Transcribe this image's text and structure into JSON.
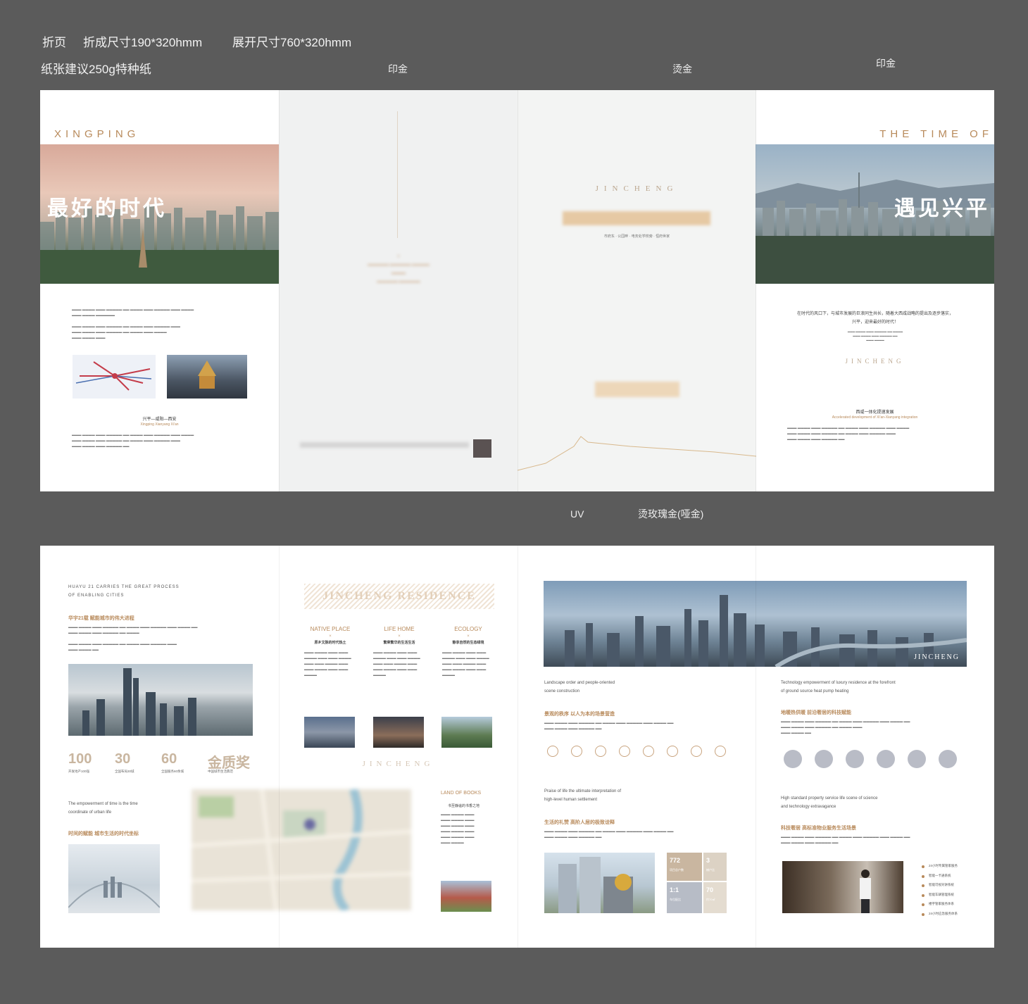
{
  "specs": {
    "fold_label": "折页",
    "folded_size": "折成尺寸190*320hmm",
    "open_size": "展开尺寸760*320hmm",
    "paper": "纸张建议250g特种纸"
  },
  "finish_labels": {
    "top_left": "印金",
    "top_center": "烫金",
    "top_right": "印金",
    "mid_left": "UV",
    "mid_right": "烫玫瑰金(哑金)"
  },
  "sheet1": {
    "p1": {
      "heading_en": "XINGPING",
      "photo_title": "最好的时代",
      "caption_title": "兴平—咸阳—西安",
      "caption_sub": "Xingping Xianyang Xi'an"
    },
    "p3": {
      "brand": "JINCHENG",
      "tagline": "市府东 · 公园畔 · 电务处学校旁 · 恒府世家"
    },
    "p4": {
      "heading_en": "THE TIME OF",
      "photo_title": "遇见兴平",
      "intro_1": "在时代的风口下，与城市发展的巨浪同生共长，随着大西咸战略的提出及逐步落实，",
      "intro_2": "兴平，迎来最好的时代！",
      "brand": "JINCHENG",
      "section_title": "西咸一体化提速发展",
      "section_sub": "Accelerated development of Xi'an-Xianyang integration"
    }
  },
  "sheet2": {
    "p1": {
      "en_1": "HUAYU 21 CARRIES THE GREAT PROCESS",
      "en_2": "OF ENABLING CITIES",
      "title": "华宇21载 赋能城市的伟大进程",
      "stats": [
        {
          "value": "100",
          "label": "开发地产100强"
        },
        {
          "value": "30",
          "label": "全国布局30城"
        },
        {
          "value": "60",
          "label": "全国服务60余城"
        },
        {
          "value": "金质奖",
          "label": "中国城市生活典范"
        }
      ],
      "en_3": "The empowerment of time is the time",
      "en_4": "coordinate of urban life",
      "title_2": "时间的赋能 城市生活的时代坐标"
    },
    "p2": {
      "banner": "JINCHENG RESIDENCE",
      "cols": [
        {
          "en": "NATIVE PLACE",
          "cn": "原乡文脉的时代热土"
        },
        {
          "en": "LIFE HOME",
          "cn": "繁荣繁华的生活生活"
        },
        {
          "en": "ECOLOGY",
          "cn": "静享自然的生态绿境"
        }
      ],
      "brand": "JINCHENG",
      "books_en": "LAND OF BOOKS",
      "books_cn": "书至静谧的书香之地"
    },
    "spread": {
      "photo_brand": "JINCHENG"
    },
    "p3": {
      "en_1": "Landscape order and people-oriented",
      "en_2": "scene construction",
      "title": "景观的秩序 以人为本的场景营造",
      "en_3": "Praise of life the ultimate interpretation of",
      "en_4": "high-level human settlement",
      "title_2": "生活的礼赞 高阶人居的极致诠释",
      "grid": [
        {
          "value": "772",
          "label": "项目总户数"
        },
        {
          "value": "3",
          "label": "梯户比"
        },
        {
          "value": "1:1",
          "label": "车位配比"
        },
        {
          "value": "70",
          "label": "约70㎡"
        }
      ]
    },
    "p4": {
      "en_1": "Technology empowerment of luxury residence at the forefront",
      "en_2": "of ground source heat pump heating",
      "title": "地暖热供暖 前沿奢居的科技赋能",
      "en_3": "High standard property service life scene of science",
      "en_4": "and technology extravagance",
      "title_2": "科技奢居 高标准物业服务生活场景",
      "list": [
        "24小时专属管家服务",
        "智能一卡通系统",
        "智能可视对讲系统",
        "智能车辆管理系统",
        "楼宇管家服务体系",
        "24小时应急服务体系"
      ]
    }
  },
  "colors": {
    "background": "#5b5b5b",
    "gold": "#b88a5b",
    "sheet": "#ffffff"
  }
}
